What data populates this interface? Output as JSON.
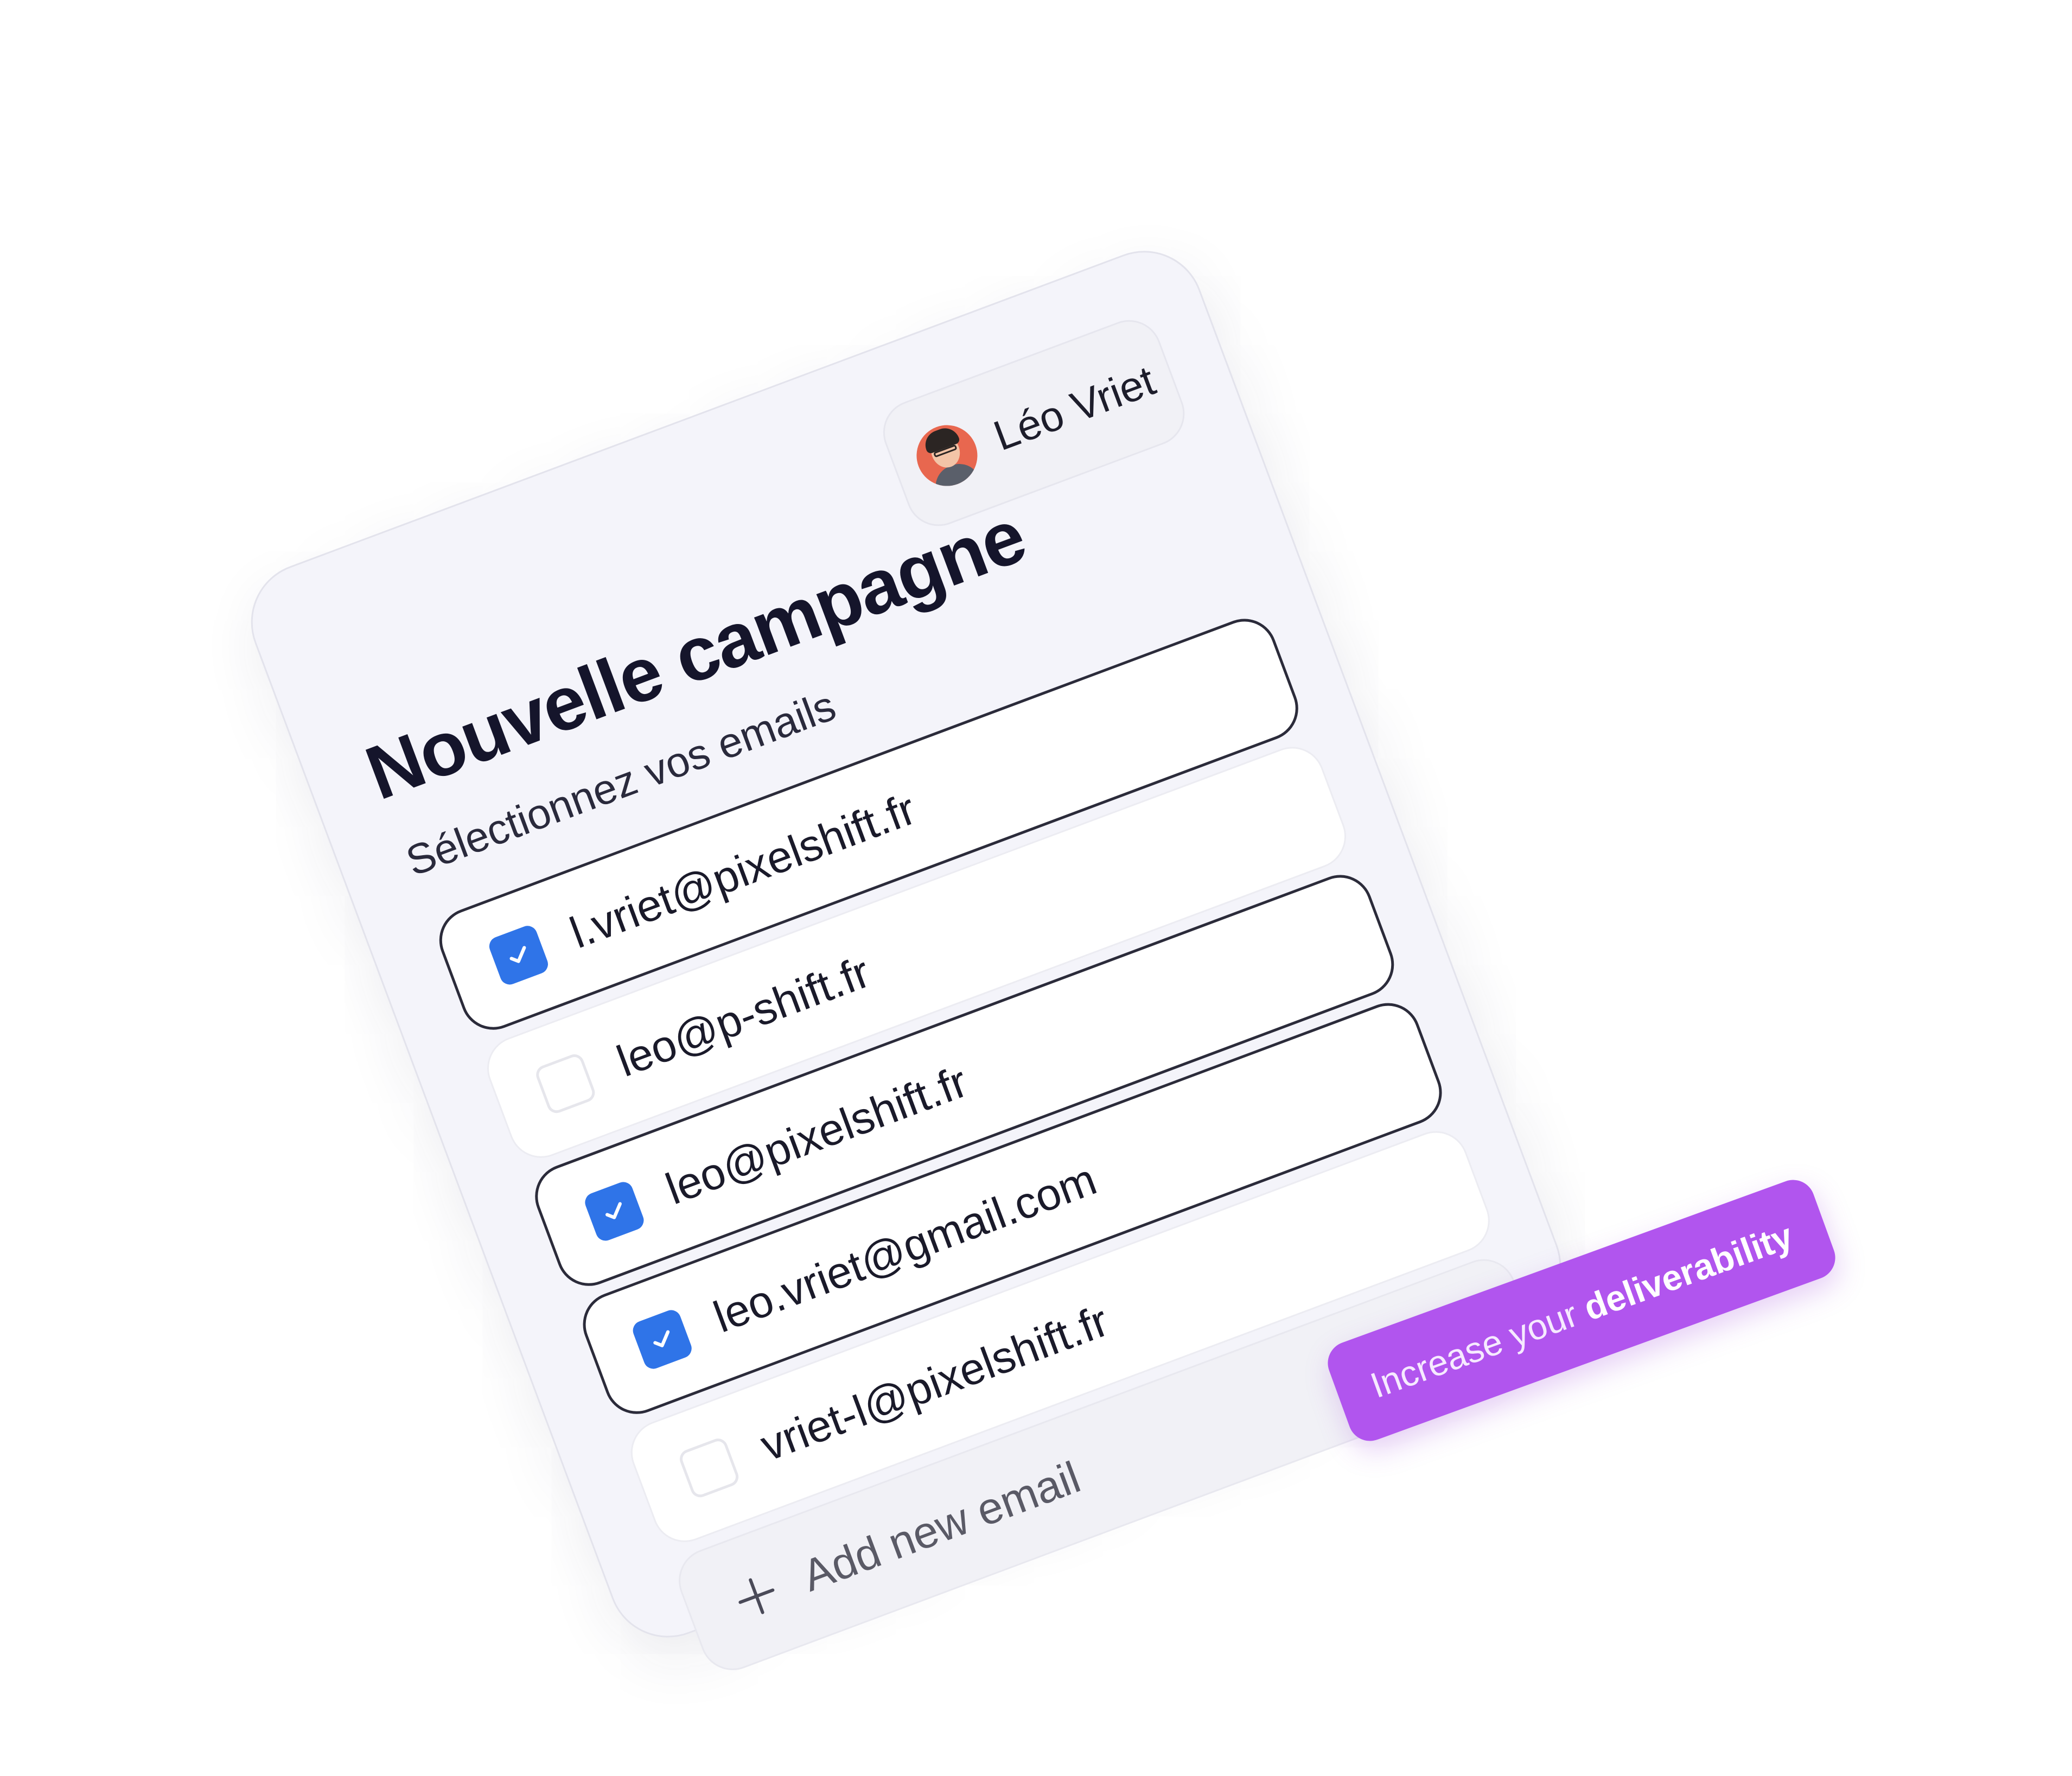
{
  "campaign": {
    "title": "Nouvelle campagne",
    "subtitle": "Sélectionnez vos emails",
    "user": {
      "name": "Léo Vriet",
      "avatar": "user-avatar-photo"
    },
    "emails": [
      {
        "address": "l.vriet@pixelshift.fr",
        "checked": true
      },
      {
        "address": "leo@p-shift.fr",
        "checked": false
      },
      {
        "address": "leo@pixelshift.fr",
        "checked": true
      },
      {
        "address": "leo.vriet@gmail.com",
        "checked": true
      },
      {
        "address": "vriet-l@pixelshift.fr",
        "checked": false
      }
    ],
    "add_email_label": "Add new email",
    "add_icon": "plus-icon"
  },
  "badge": {
    "prefix": "Increase your ",
    "emphasis": "deliverability",
    "color": "#b155ee"
  },
  "colors": {
    "checkbox_checked": "#2f74e8",
    "card_background": "#f4f4fa",
    "title_text": "#15152b"
  }
}
